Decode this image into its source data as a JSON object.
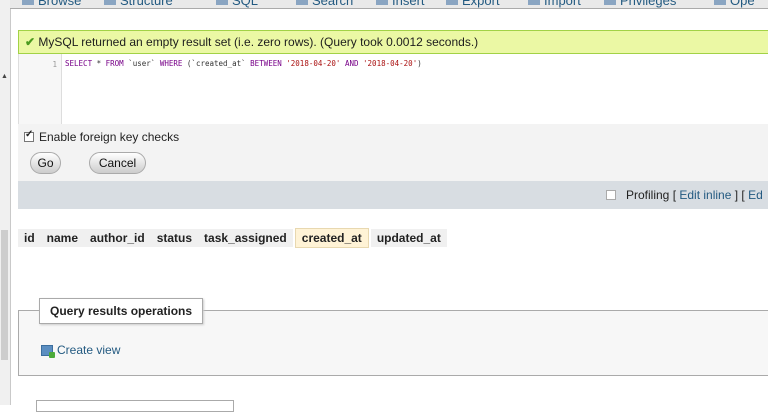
{
  "tabs": [
    {
      "label": "Browse",
      "icon": "table-icon"
    },
    {
      "label": "Structure",
      "icon": "structure-icon"
    },
    {
      "label": "SQL",
      "icon": "sql-icon"
    },
    {
      "label": "Search",
      "icon": "search-icon"
    },
    {
      "label": "Insert",
      "icon": "insert-icon"
    },
    {
      "label": "Export",
      "icon": "export-icon"
    },
    {
      "label": "Import",
      "icon": "import-icon"
    },
    {
      "label": "Privileges",
      "icon": "privileges-icon"
    },
    {
      "label": "Ope",
      "icon": "operations-icon"
    }
  ],
  "message": {
    "text": "MySQL returned an empty result set (i.e. zero rows). (Query took 0.0012 seconds.)",
    "icon": "success-check-icon",
    "color": "#ebf8a4"
  },
  "sql": {
    "line_number": "1",
    "tokens": {
      "t1": "SELECT",
      "t2": " * ",
      "t3": "FROM",
      "t4": " `user` ",
      "t5": "WHERE",
      "t6": " (`created_at` ",
      "t7": "BETWEEN",
      "t8": " ",
      "t9": "'2018-04-20'",
      "t10": " ",
      "t11": "AND",
      "t12": " ",
      "t13": "'2018-04-20'",
      "t14": ")"
    }
  },
  "options": {
    "foreign_key_label": "Enable foreign key checks",
    "foreign_key_checked": true,
    "go_label": "Go",
    "cancel_label": "Cancel"
  },
  "profiling": {
    "label": "Profiling",
    "lb1": " [ ",
    "edit_inline": "Edit inline",
    "mid": " ] [ ",
    "edit": "Ed"
  },
  "columns": [
    "id",
    "name",
    "author_id",
    "status",
    "task_assigned",
    "created_at",
    "updated_at"
  ],
  "sorted_column": "created_at",
  "operations": {
    "legend": "Query results operations",
    "create_view_label": "Create view",
    "create_view_icon": "create-view-icon"
  },
  "colors": {
    "link": "#235a81",
    "success_border": "#a2d246"
  }
}
